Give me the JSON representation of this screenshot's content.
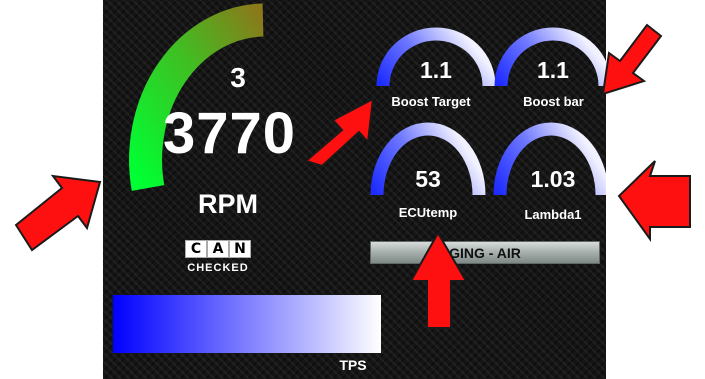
{
  "dashboard": {
    "gear": "3",
    "rpm_value": "3770",
    "rpm_label": "RPM",
    "gauges": [
      {
        "value": "1.1",
        "label": "Boost Target"
      },
      {
        "value": "1.1",
        "label": "Boost bar"
      },
      {
        "value": "53",
        "label": "ECUtemp"
      },
      {
        "value": "1.03",
        "label": "Lambda1"
      }
    ],
    "logo": {
      "letters": [
        "C",
        "A",
        "N"
      ],
      "subtitle": "CHECKED"
    },
    "status_text": "GING - AIR",
    "tps_label": "TPS"
  },
  "colors": {
    "background": "#151515",
    "rpm_arc_start": "#00ff33",
    "rpm_arc_end": "#8a7a1a",
    "gauge_blue": "#2a3cff",
    "gauge_white": "#e8e8ff",
    "tps_fill_start": "#0000ff",
    "arrow_red": "#ff1010"
  },
  "icons": [
    "arrow-icon"
  ]
}
